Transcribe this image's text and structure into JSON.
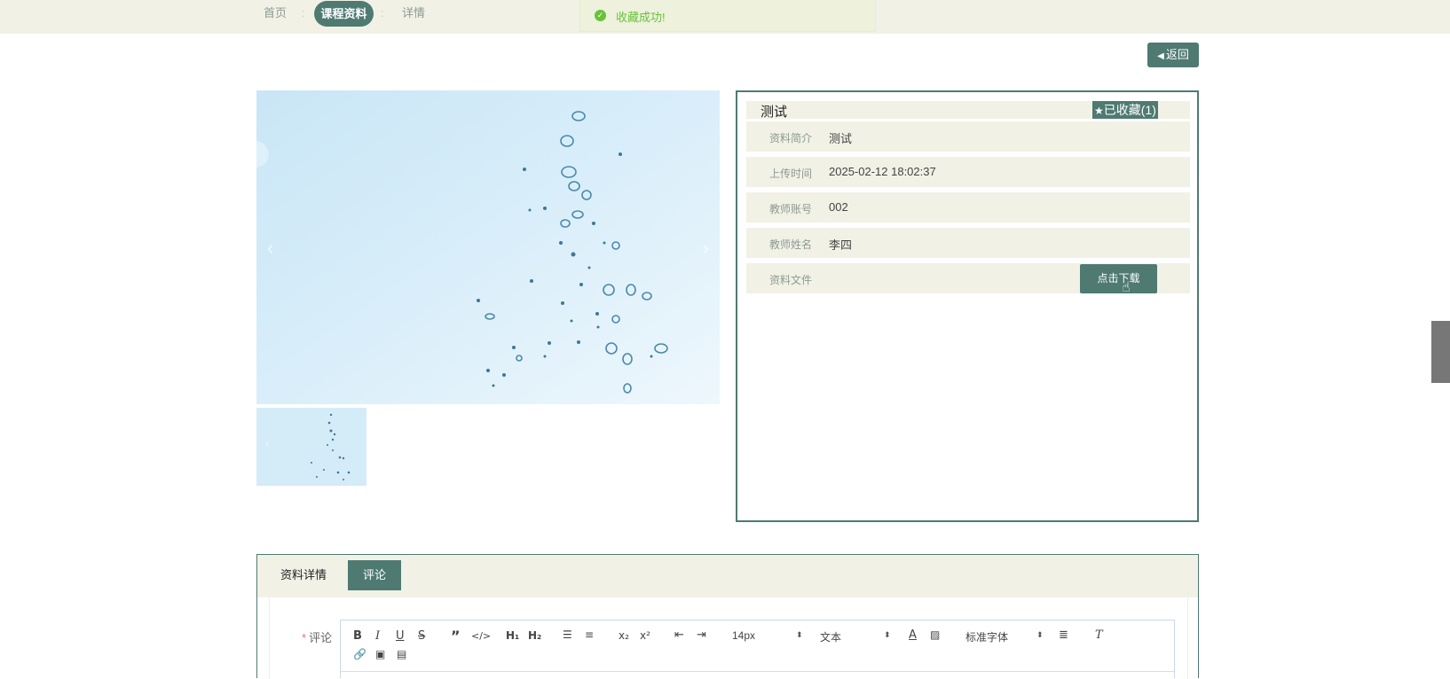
{
  "breadcrumb": {
    "home": "首页",
    "separator": ":",
    "current": "课程资料",
    "detail": "详情"
  },
  "toast": {
    "message": "收藏成功!",
    "icon": "check-circle-icon",
    "color": "#67c23a"
  },
  "back_button": {
    "label": "返回",
    "icon": "caret-left-icon"
  },
  "carousel": {
    "prev_icon": "chevron-left-icon",
    "next_icon": "chevron-right-icon"
  },
  "info": {
    "title": "测试",
    "favorite_label": "已收藏(1)",
    "favorite_icon": "star-icon",
    "rows": [
      {
        "label": "资料简介",
        "value": "测试"
      },
      {
        "label": "上传时间",
        "value": "2025-02-12 18:02:37"
      },
      {
        "label": "教师账号",
        "value": "002"
      },
      {
        "label": "教师姓名",
        "value": "李四"
      },
      {
        "label": "资料文件",
        "value": ""
      }
    ],
    "download_button": "点击下载"
  },
  "tabs": [
    {
      "label": "资料详情",
      "active": false
    },
    {
      "label": "评论",
      "active": true
    }
  ],
  "comment_form": {
    "required_mark": "*",
    "label": "评论",
    "font_size_select": "14px",
    "header_select": "文本",
    "font_family_select": "标准字体"
  },
  "colors": {
    "accent": "#4e7a72",
    "panel_bg": "#f1f1e6",
    "success": "#67c23a"
  }
}
